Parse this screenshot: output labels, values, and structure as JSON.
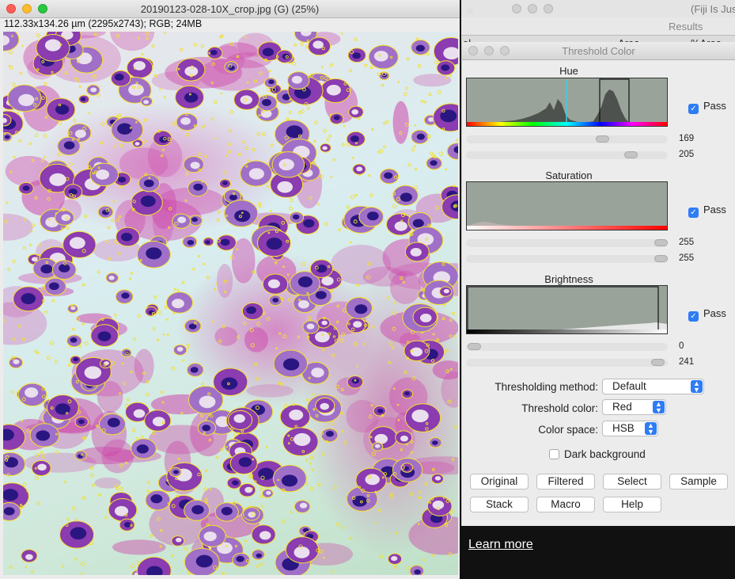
{
  "image_window": {
    "title": "20190123-028-10X_crop.jpg (G) (25%)",
    "info": "112.33x134.26 µm (2295x2743); RGB; 24MB"
  },
  "fiji_window": {
    "title": "(Fiji Is Jus"
  },
  "results_window": {
    "title": "Results",
    "col_partial": "al",
    "col_area": "Area",
    "col_pct_area": "%Area"
  },
  "threshold": {
    "title": "Threshold Color",
    "hue": {
      "label": "Hue",
      "pass_label": "Pass",
      "min": "169",
      "max": "205"
    },
    "saturation": {
      "label": "Saturation",
      "pass_label": "Pass",
      "min": "255",
      "max": "255"
    },
    "brightness": {
      "label": "Brightness",
      "pass_label": "Pass",
      "min": "0",
      "max": "241"
    },
    "method_label": "Thresholding method:",
    "method_value": "Default",
    "color_label": "Threshold color:",
    "color_value": "Red",
    "space_label": "Color space:",
    "space_value": "HSB",
    "dark_bg_label": "Dark background",
    "buttons": [
      "Original",
      "Filtered",
      "Select",
      "Sample",
      "Stack",
      "Macro",
      "Help"
    ]
  },
  "learn_more": "Learn more",
  "colors": {
    "accent": "#2e7cf6",
    "hist_bg": "#9aa39a",
    "stain_pink": "#d050b0",
    "nucleus": "#3a1a8a"
  }
}
